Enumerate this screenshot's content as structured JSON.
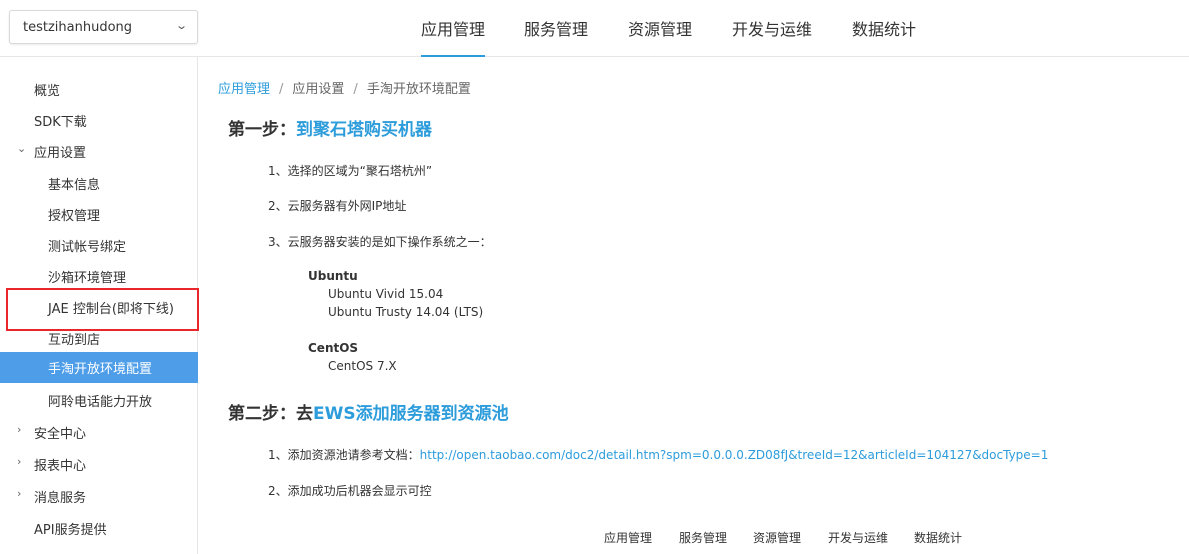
{
  "app_selector": {
    "value": "testzihanhudong"
  },
  "top_nav": [
    "应用管理",
    "服务管理",
    "资源管理",
    "开发与运维",
    "数据统计"
  ],
  "sidebar": {
    "items": [
      {
        "label": "概览"
      },
      {
        "label": "SDK下载"
      },
      {
        "label": "应用设置",
        "expanded": true
      },
      {
        "label": "基本信息"
      },
      {
        "label": "授权管理"
      },
      {
        "label": "测试帐号绑定"
      },
      {
        "label": "沙箱环境管理"
      },
      {
        "label": "JAE 控制台(即将下线)"
      },
      {
        "label": "互动到店"
      },
      {
        "label": "手淘开放环境配置",
        "selected": true
      },
      {
        "label": "阿聆电话能力开放"
      },
      {
        "label": "安全中心"
      },
      {
        "label": "报表中心"
      },
      {
        "label": "消息服务"
      },
      {
        "label": "API服务提供"
      }
    ]
  },
  "breadcrumb": [
    "应用管理",
    "应用设置",
    "手淘开放环境配置"
  ],
  "step1": {
    "prefix": "第一步：",
    "title": "到聚石塔购买机器",
    "items": [
      "1、选择的区域为“聚石塔杭州”",
      "2、云服务器有外网IP地址",
      "3、云服务器安装的是如下操作系统之一："
    ],
    "os": [
      {
        "name": "Ubuntu",
        "versions": [
          "Ubuntu Vivid 15.04",
          "Ubuntu Trusty 14.04 (LTS)"
        ]
      },
      {
        "name": "CentOS",
        "versions": [
          "CentOS 7.X"
        ]
      }
    ]
  },
  "step2": {
    "prefix": "第二步：去",
    "title": "EWS添加服务器到资源池",
    "item1_prefix": "1、添加资源池请参考文档：",
    "item1_link": "http://open.taobao.com/doc2/detail.htm?spm=0.0.0.0.ZD08fJ&treeId=12&articleId=104127&docType=1",
    "item2": "2、添加成功后机器会显示可控"
  },
  "footer_nav": [
    "应用管理",
    "服务管理",
    "资源管理",
    "开发与运维",
    "数据统计"
  ],
  "colors": {
    "accent": "#2d9cdb",
    "selected_bg": "#4d9de8",
    "highlight_border": "#e8262b"
  }
}
